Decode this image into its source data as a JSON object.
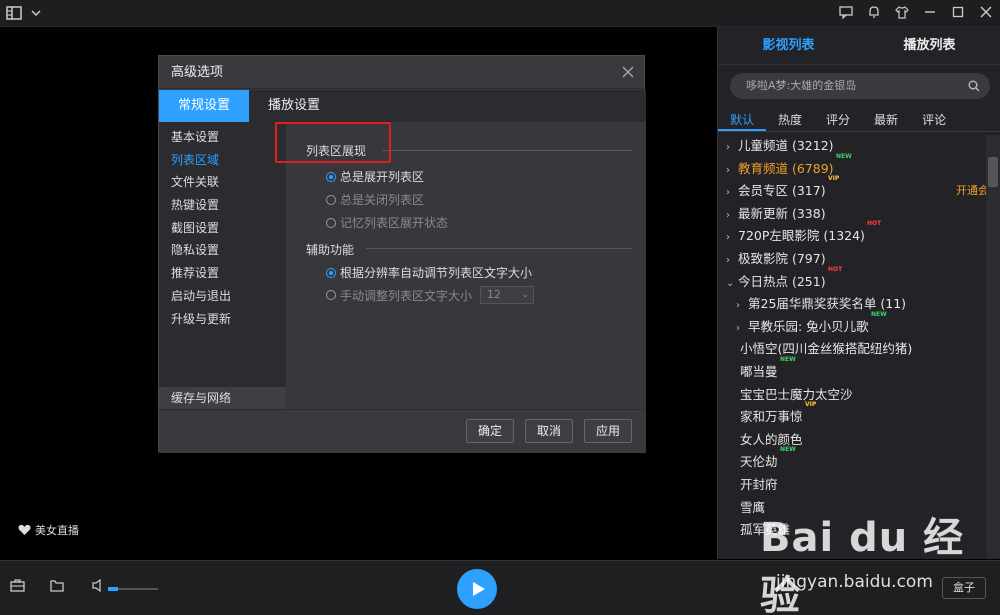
{
  "sidebar": {
    "tabs": [
      "影视列表",
      "播放列表"
    ],
    "search_placeholder": "哆啦A梦:大雄的金银岛",
    "sorts": [
      "默认",
      "热度",
      "评分",
      "最新",
      "评论"
    ],
    "vip_open": "开通会员",
    "items": [
      {
        "label": "儿童频道 (3212)",
        "level": 0,
        "chev": "›",
        "badge": "",
        "badge_text": ""
      },
      {
        "label": "教育频道 (6789)",
        "level": 0,
        "chev": "›",
        "badge": "new",
        "badge_text": "NEW",
        "highlight": true
      },
      {
        "label": "会员专区 (317)",
        "level": 0,
        "chev": "›",
        "badge": "vip",
        "badge_text": "VIP"
      },
      {
        "label": "最新更新 (338)",
        "level": 0,
        "chev": "›",
        "badge": "",
        "badge_text": ""
      },
      {
        "label": "720P左眼影院 (1324)",
        "level": 0,
        "chev": "›",
        "badge": "hot",
        "badge_text": "HOT"
      },
      {
        "label": "极致影院 (797)",
        "level": 0,
        "chev": "›",
        "badge": "",
        "badge_text": ""
      },
      {
        "label": "今日热点 (251)",
        "level": 0,
        "chev": "⌄",
        "badge": "hot",
        "badge_text": "HOT"
      },
      {
        "label": "第25届华鼎奖获奖名单 (11)",
        "level": 1,
        "chev": "›",
        "badge": "",
        "badge_text": ""
      },
      {
        "label": "早教乐园: 兔小贝儿歌",
        "level": 1,
        "chev": "›",
        "badge": "new",
        "badge_text": "NEW"
      },
      {
        "label": "小悟空(四川金丝猴搭配纽约猪)",
        "level": 2,
        "chev": "",
        "badge": "",
        "badge_text": ""
      },
      {
        "label": "嘟当曼",
        "level": 2,
        "chev": "",
        "badge": "new",
        "badge_text": "NEW"
      },
      {
        "label": "宝宝巴士魔力太空沙",
        "level": 2,
        "chev": "",
        "badge": "",
        "badge_text": ""
      },
      {
        "label": "家和万事惊",
        "level": 2,
        "chev": "",
        "badge": "vip",
        "badge_text": "VIP"
      },
      {
        "label": "女人的颜色",
        "level": 2,
        "chev": "",
        "badge": "",
        "badge_text": ""
      },
      {
        "label": "天伦劫",
        "level": 2,
        "chev": "",
        "badge": "new",
        "badge_text": "NEW"
      },
      {
        "label": "开封府",
        "level": 2,
        "chev": "",
        "badge": "",
        "badge_text": ""
      },
      {
        "label": "雪鹰",
        "level": 2,
        "chev": "",
        "badge": "",
        "badge_text": ""
      },
      {
        "label": "孤军英雄",
        "level": 2,
        "chev": "",
        "badge": "",
        "badge_text": ""
      }
    ]
  },
  "player": {
    "beauty_live": "美女直播",
    "box_button": "盒子"
  },
  "watermark": {
    "main": "Bai du 经验",
    "sub": "jingyan.baidu.com"
  },
  "dialog": {
    "title": "高级选项",
    "tabs": [
      "常规设置",
      "播放设置"
    ],
    "nav": [
      "基本设置",
      "列表区域",
      "文件关联",
      "热键设置",
      "截图设置",
      "隐私设置",
      "推荐设置",
      "启动与退出",
      "升级与更新"
    ],
    "nav_cache": "缓存与网络",
    "section1_title": "列表区展现",
    "section1_options": [
      "总是展开列表区",
      "总是关闭列表区",
      "记忆列表区展开状态"
    ],
    "section2_title": "辅助功能",
    "section2_opt1": "根据分辨率自动调节列表区文字大小",
    "section2_opt2": "手动调整列表区文字大小",
    "font_size_value": "12",
    "ok": "确定",
    "cancel": "取消",
    "apply": "应用"
  },
  "colors": {
    "accent": "#2ea0ff",
    "highlight": "#f0a02a",
    "new": "#3ed36b",
    "hot": "#ff4040",
    "vip": "#ffcc33",
    "annotation": "#e02020"
  }
}
